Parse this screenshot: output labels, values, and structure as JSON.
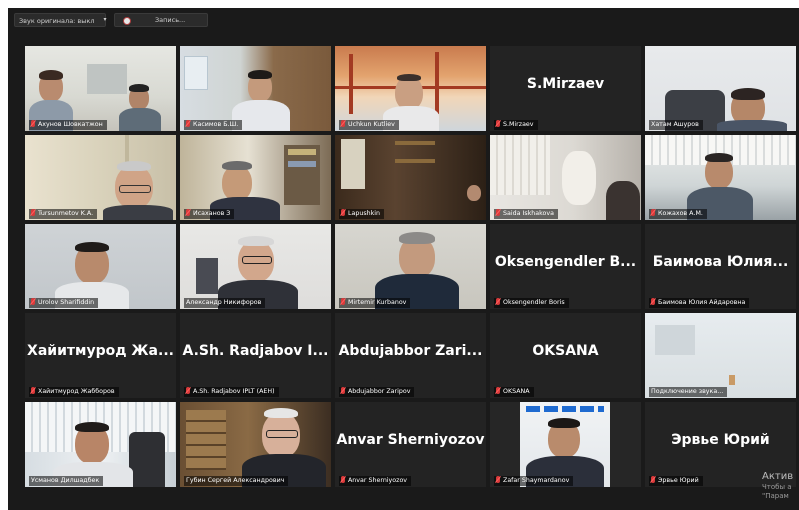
{
  "toolbar": {
    "audio_label": "Звук оригинала: выкл",
    "audio_caret": "▾",
    "record_label": "Запись..."
  },
  "tiles": [
    {
      "name": "Ахунов Шовкатжон",
      "big": ""
    },
    {
      "name": "Касимов Б.Ш.",
      "big": ""
    },
    {
      "name": "Uchkun Kutliev",
      "big": ""
    },
    {
      "name": "S.Mirzaev",
      "big": "S.Mirzaev"
    },
    {
      "name": "Хатам Ашуров",
      "big": ""
    },
    {
      "name": "Tursunmetov K.A.",
      "big": ""
    },
    {
      "name": "Исаханов З",
      "big": ""
    },
    {
      "name": "Lapushkin",
      "big": ""
    },
    {
      "name": "Saida Iskhakova",
      "big": ""
    },
    {
      "name": "Кожахов А.М.",
      "big": ""
    },
    {
      "name": "Urolov Sharifiddin",
      "big": ""
    },
    {
      "name": "Александр Никифоров",
      "big": ""
    },
    {
      "name": "Mirtemir Kurbanov",
      "big": ""
    },
    {
      "name": "Oksengendler Boris",
      "big": "Oksengendler B..."
    },
    {
      "name": "Баимова Юлия Айдаровна",
      "big": "Баимова Юлия..."
    },
    {
      "name": "Хайитмурод Жабборов",
      "big": "Хайитмурод Жа..."
    },
    {
      "name": "A.Sh. Radjabov IPLT (AEH)",
      "big": "A.Sh. Radjabov I..."
    },
    {
      "name": "Abdujabbor Zaripov",
      "big": "Abdujabbor Zari..."
    },
    {
      "name": "OKSANA",
      "big": "OKSANA"
    },
    {
      "name": "Подключение звука...",
      "big": ""
    },
    {
      "name": "Усманов Дилшадбек",
      "big": ""
    },
    {
      "name": "Губин Сергей Александрович",
      "big": ""
    },
    {
      "name": "Anvar Sherniyozov",
      "big": "Anvar Sherniyozov"
    },
    {
      "name": "Zafar Shaymardanov",
      "big": ""
    },
    {
      "name": "Эрвье Юрий",
      "big": "Эрвье Юрий"
    }
  ],
  "watermark": {
    "line1": "Актив",
    "line2": "Чтобы а",
    "line3": "\"Парам"
  }
}
